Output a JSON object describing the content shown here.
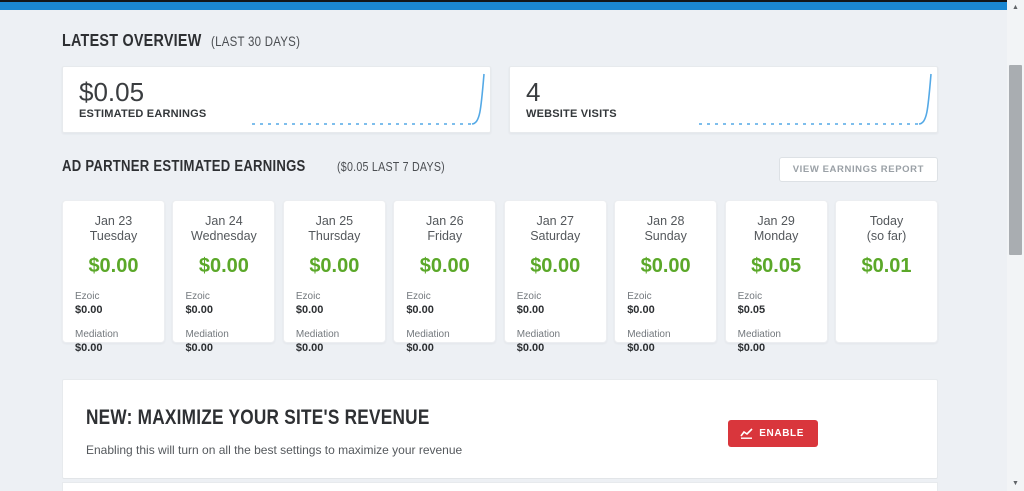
{
  "colors": {
    "top_bar_blue": "#1b87d2",
    "sparkline_blue": "#54a9e6",
    "earnings_green": "#5ba829",
    "enable_red": "#d9363c",
    "page_background": "#edf0f4"
  },
  "overview": {
    "title": "LATEST OVERVIEW",
    "subtitle": "(LAST 30 DAYS)",
    "cards": [
      {
        "value": "$0.05",
        "label": "ESTIMATED EARNINGS"
      },
      {
        "value": "4",
        "label": "WEBSITE VISITS"
      }
    ]
  },
  "ad_partner": {
    "title": "AD PARTNER ESTIMATED EARNINGS",
    "subtitle": "($0.05 LAST 7 DAYS)",
    "report_button": "VIEW EARNINGS REPORT",
    "days": [
      {
        "date": "Jan 23",
        "day": "Tuesday",
        "total": "$0.00",
        "ezoic_label": "Ezoic",
        "ezoic": "$0.00",
        "mediation_label": "Mediation",
        "mediation": "$0.00"
      },
      {
        "date": "Jan 24",
        "day": "Wednesday",
        "total": "$0.00",
        "ezoic_label": "Ezoic",
        "ezoic": "$0.00",
        "mediation_label": "Mediation",
        "mediation": "$0.00"
      },
      {
        "date": "Jan 25",
        "day": "Thursday",
        "total": "$0.00",
        "ezoic_label": "Ezoic",
        "ezoic": "$0.00",
        "mediation_label": "Mediation",
        "mediation": "$0.00"
      },
      {
        "date": "Jan 26",
        "day": "Friday",
        "total": "$0.00",
        "ezoic_label": "Ezoic",
        "ezoic": "$0.00",
        "mediation_label": "Mediation",
        "mediation": "$0.00"
      },
      {
        "date": "Jan 27",
        "day": "Saturday",
        "total": "$0.00",
        "ezoic_label": "Ezoic",
        "ezoic": "$0.00",
        "mediation_label": "Mediation",
        "mediation": "$0.00"
      },
      {
        "date": "Jan 28",
        "day": "Sunday",
        "total": "$0.00",
        "ezoic_label": "Ezoic",
        "ezoic": "$0.00",
        "mediation_label": "Mediation",
        "mediation": "$0.00"
      },
      {
        "date": "Jan 29",
        "day": "Monday",
        "total": "$0.05",
        "ezoic_label": "Ezoic",
        "ezoic": "$0.05",
        "mediation_label": "Mediation",
        "mediation": "$0.00"
      },
      {
        "date": "Today",
        "day": "(so far)",
        "total": "$0.01"
      }
    ]
  },
  "promo": {
    "title": "NEW: MAXIMIZE YOUR SITE'S REVENUE",
    "description": "Enabling this will turn on all the best settings to maximize your revenue",
    "enable_button": "ENABLE"
  },
  "scrollbar": {
    "up_arrow": "▲",
    "down_arrow": "▼"
  }
}
